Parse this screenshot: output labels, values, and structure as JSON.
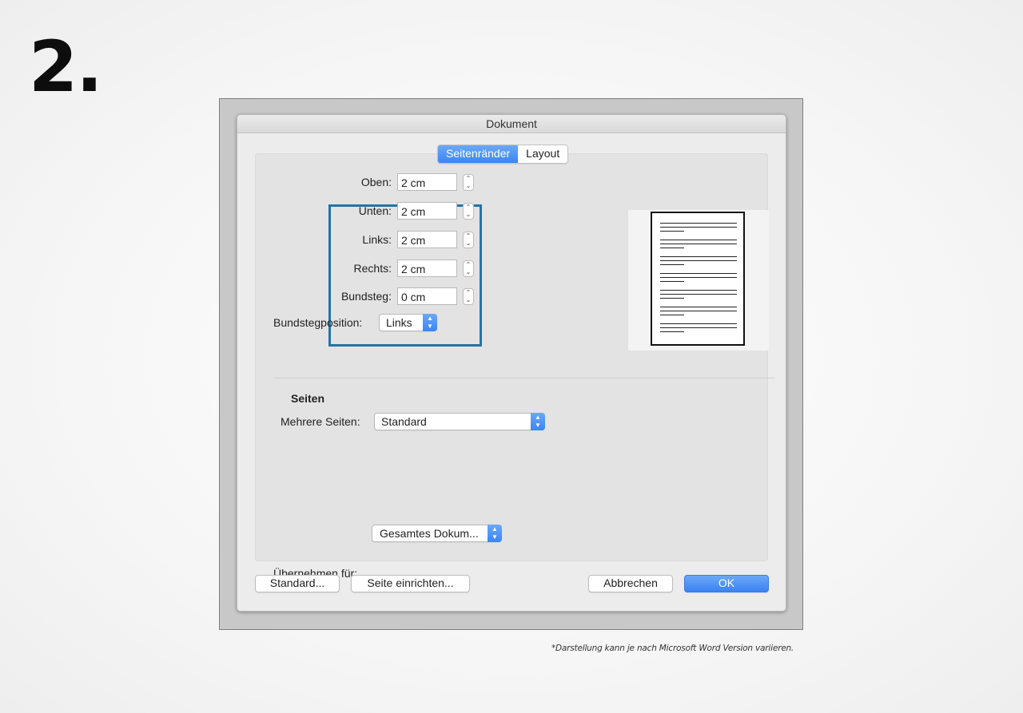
{
  "step_number": "2.",
  "window": {
    "title": "Dokument"
  },
  "tabs": [
    {
      "label": "Seitenränder",
      "active": true
    },
    {
      "label": "Layout",
      "active": false
    }
  ],
  "margins": [
    {
      "label": "Oben:",
      "value": "2 cm"
    },
    {
      "label": "Unten:",
      "value": "2 cm"
    },
    {
      "label": "Links:",
      "value": "2 cm"
    },
    {
      "label": "Rechts:",
      "value": "2 cm"
    },
    {
      "label": "Bundsteg:",
      "value": "0 cm"
    }
  ],
  "gutter_position": {
    "label": "Bundstegposition:",
    "value": "Links"
  },
  "pages_section": {
    "heading": "Seiten",
    "multiple_pages_label": "Mehrere Seiten:",
    "multiple_pages_value": "Standard"
  },
  "apply_to": {
    "label": "Übernehmen für:",
    "value": "Gesamtes Dokum..."
  },
  "buttons": {
    "default": "Standard...",
    "page_setup": "Seite einrichten...",
    "cancel": "Abbrechen",
    "ok": "OK"
  },
  "footnote": "*Darstellung kann je nach Microsoft Word Version variieren.",
  "colors": {
    "accent": "#3d85f2",
    "highlight_box": "#2474a6"
  },
  "icons": {
    "stepper": "stepper-icon",
    "popup": "chevron-updown-icon"
  }
}
